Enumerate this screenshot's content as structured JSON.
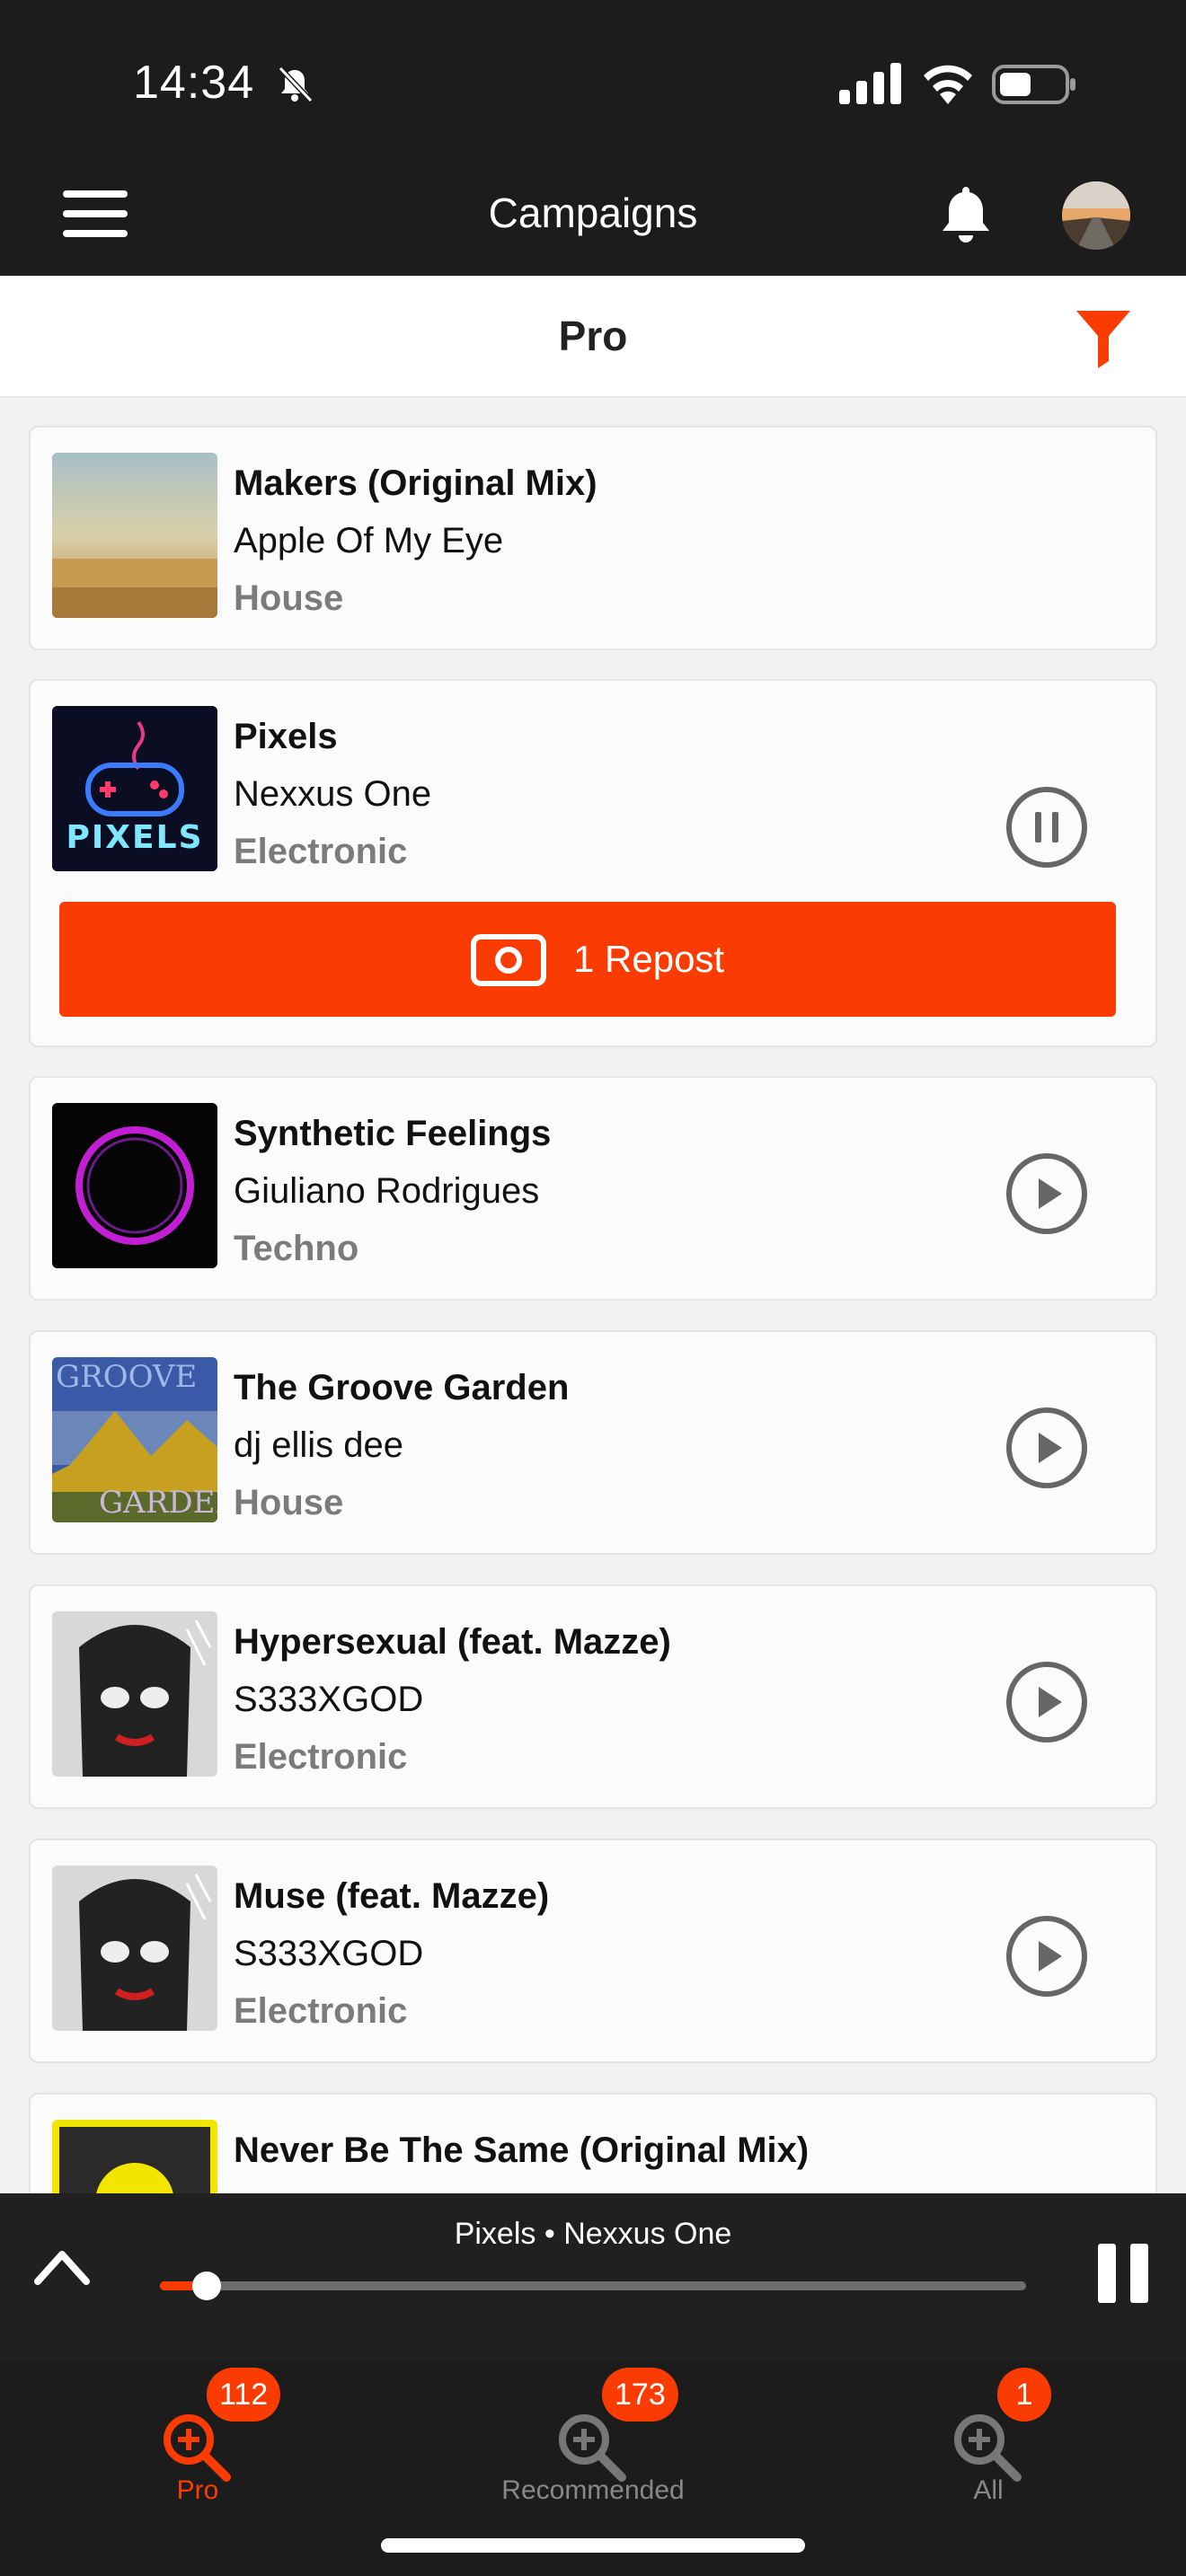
{
  "status_bar": {
    "time": "14:34"
  },
  "app_bar": {
    "title": "Campaigns"
  },
  "subheader": {
    "title": "Pro"
  },
  "colors": {
    "accent": "#fb3c02",
    "dark": "#1c1c1c"
  },
  "tracks": [
    {
      "title": "Makers (Original Mix)",
      "artist": "Apple Of My Eye",
      "genre": "House",
      "state": "none"
    },
    {
      "title": "Pixels",
      "artist": "Nexxus One",
      "genre": "Electronic",
      "state": "pause",
      "repost_label": "1 Repost",
      "art_text": "PIXELS"
    },
    {
      "title": "Synthetic Feelings",
      "artist": "Giuliano Rodrigues",
      "genre": "Techno",
      "state": "play"
    },
    {
      "title": "The Groove Garden",
      "artist": "dj ellis dee",
      "genre": "House",
      "state": "play",
      "art_text_top": "GROOVE",
      "art_text_bottom": "GARDEN"
    },
    {
      "title": "Hypersexual (feat. Mazze)",
      "artist": "S333XGOD",
      "genre": "Electronic",
      "state": "play"
    },
    {
      "title": "Muse (feat. Mazze)",
      "artist": "S333XGOD",
      "genre": "Electronic",
      "state": "play"
    },
    {
      "title": "Never Be The Same (Original Mix)"
    }
  ],
  "player": {
    "now_playing": "Pixels  •  Nexxus One",
    "progress": 0.054
  },
  "tabs": [
    {
      "label": "Pro",
      "badge": "112",
      "active": true
    },
    {
      "label": "Recommended",
      "badge": "173",
      "active": false
    },
    {
      "label": "All",
      "badge": "1",
      "active": false
    }
  ]
}
